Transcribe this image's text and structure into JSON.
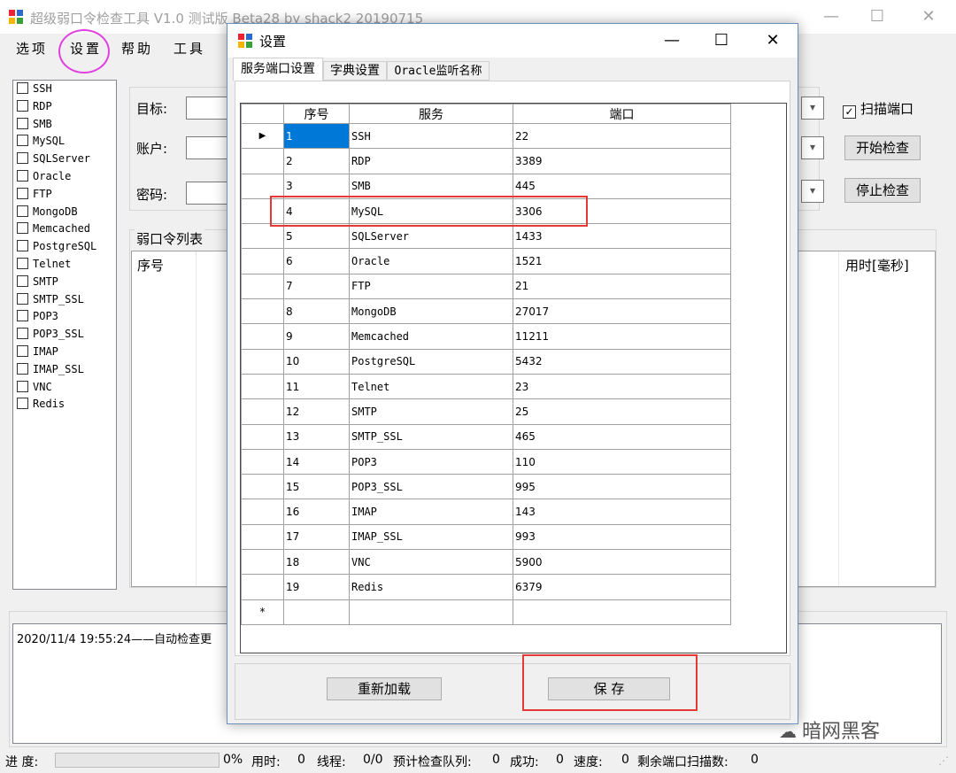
{
  "app": {
    "title": "超级弱口令检查工具 V1.0 测试版 Beta28 by shack2 20190715",
    "window_controls": {
      "minimize": "—",
      "maximize": "☐",
      "close": "✕"
    }
  },
  "menu": [
    "选项",
    "设置",
    "帮助",
    "工具"
  ],
  "services": [
    "SSH",
    "RDP",
    "SMB",
    "MySQL",
    "SQLServer",
    "Oracle",
    "FTP",
    "MongoDB",
    "Memcached",
    "PostgreSQL",
    "Telnet",
    "SMTP",
    "SMTP_SSL",
    "POP3",
    "POP3_SSL",
    "IMAP",
    "IMAP_SSL",
    "VNC",
    "Redis"
  ],
  "form": {
    "target_label": "目标:",
    "account_label": "账户:",
    "password_label": "密码:",
    "scan_port_label": "扫描端口",
    "scan_port_checked": true,
    "start_button": "开始检查",
    "stop_button": "停止检查"
  },
  "results": {
    "group_label": "弱口令列表",
    "col_index": "序号",
    "col_time": "用时[毫秒]"
  },
  "log": {
    "text": "2020/11/4 19:55:24——自动检查更"
  },
  "status": {
    "progress_label": "进 度:",
    "progress_value": "0%",
    "time_label": "用时:",
    "time_value": "0",
    "thread_label": "线程:",
    "thread_value": "0/0",
    "queue_label": "预计检查队列:",
    "queue_value": "0",
    "success_label": "成功:",
    "success_value": "0",
    "speed_label": "速度:",
    "speed_value": "0",
    "remain_label": "剩余端口扫描数:",
    "remain_value": "0"
  },
  "watermark": "暗网黑客",
  "dialog": {
    "title": "设置",
    "tabs": [
      "服务端口设置",
      "字典设置",
      "Oracle监听名称"
    ],
    "columns": [
      "序号",
      "服务",
      "端口"
    ],
    "rows": [
      {
        "index": "1",
        "service": "SSH",
        "port": "22"
      },
      {
        "index": "2",
        "service": "RDP",
        "port": "3389"
      },
      {
        "index": "3",
        "service": "SMB",
        "port": "445"
      },
      {
        "index": "4",
        "service": "MySQL",
        "port": "3306"
      },
      {
        "index": "5",
        "service": "SQLServer",
        "port": "1433"
      },
      {
        "index": "6",
        "service": "Oracle",
        "port": "1521"
      },
      {
        "index": "7",
        "service": "FTP",
        "port": "21"
      },
      {
        "index": "8",
        "service": "MongoDB",
        "port": "27017"
      },
      {
        "index": "9",
        "service": "Memcached",
        "port": "11211"
      },
      {
        "index": "10",
        "service": "PostgreSQL",
        "port": "5432"
      },
      {
        "index": "11",
        "service": "Telnet",
        "port": "23"
      },
      {
        "index": "12",
        "service": "SMTP",
        "port": "25"
      },
      {
        "index": "13",
        "service": "SMTP_SSL",
        "port": "465"
      },
      {
        "index": "14",
        "service": "POP3",
        "port": "110"
      },
      {
        "index": "15",
        "service": "POP3_SSL",
        "port": "995"
      },
      {
        "index": "16",
        "service": "IMAP",
        "port": "143"
      },
      {
        "index": "17",
        "service": "IMAP_SSL",
        "port": "993"
      },
      {
        "index": "18",
        "service": "VNC",
        "port": "5900"
      },
      {
        "index": "19",
        "service": "Redis",
        "port": "6379"
      }
    ],
    "current_row_marker": "▶",
    "new_row_marker": "*",
    "reload_button": "重新加载",
    "save_button": "保 存"
  }
}
